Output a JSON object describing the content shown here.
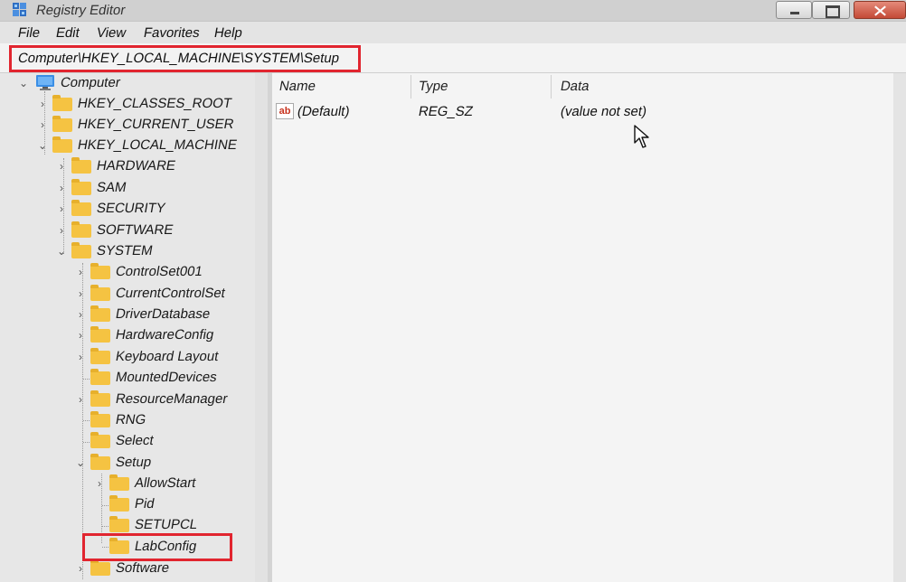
{
  "window": {
    "title": "Registry Editor"
  },
  "menu": [
    "File",
    "Edit",
    "View",
    "Favorites",
    "Help"
  ],
  "address": "Computer\\HKEY_LOCAL_MACHINE\\SYSTEM\\Setup",
  "tree": {
    "root": "Computer",
    "items": [
      {
        "label": "HKEY_CLASSES_ROOT",
        "expander": "›"
      },
      {
        "label": "HKEY_CURRENT_USER",
        "expander": "›"
      },
      {
        "label": "HKEY_LOCAL_MACHINE",
        "expander": "⌄"
      },
      {
        "label": "HARDWARE",
        "expander": "›"
      },
      {
        "label": "SAM",
        "expander": "›"
      },
      {
        "label": "SECURITY",
        "expander": "›"
      },
      {
        "label": "SOFTWARE",
        "expander": "›"
      },
      {
        "label": "SYSTEM",
        "expander": "⌄"
      },
      {
        "label": "ControlSet001",
        "expander": "›"
      },
      {
        "label": "CurrentControlSet",
        "expander": "›"
      },
      {
        "label": "DriverDatabase",
        "expander": "›"
      },
      {
        "label": "HardwareConfig",
        "expander": "›"
      },
      {
        "label": "Keyboard Layout",
        "expander": "›"
      },
      {
        "label": "MountedDevices",
        "expander": ""
      },
      {
        "label": "ResourceManager",
        "expander": "›"
      },
      {
        "label": "RNG",
        "expander": ""
      },
      {
        "label": "Select",
        "expander": ""
      },
      {
        "label": "Setup",
        "expander": "⌄"
      },
      {
        "label": "AllowStart",
        "expander": "›"
      },
      {
        "label": "Pid",
        "expander": ""
      },
      {
        "label": "SETUPCL",
        "expander": ""
      },
      {
        "label": "LabConfig",
        "expander": ""
      },
      {
        "label": "Software",
        "expander": "›"
      }
    ]
  },
  "values": {
    "headers": {
      "name": "Name",
      "type": "Type",
      "data": "Data"
    },
    "rows": [
      {
        "icon": "ab",
        "name": "(Default)",
        "type": "REG_SZ",
        "data": "(value not set)"
      }
    ]
  },
  "colors": {
    "highlight": "#e1252f",
    "folder": "#f5c342",
    "computer": "#3a8ee6"
  }
}
